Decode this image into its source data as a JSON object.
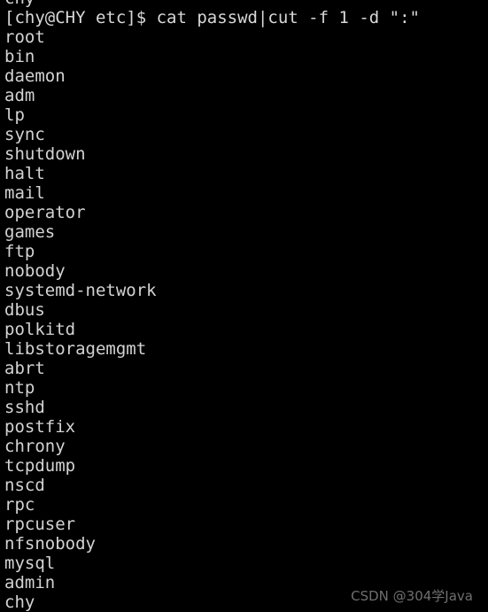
{
  "terminal": {
    "background_color": "#000000",
    "foreground_color": "#d3d3d3",
    "clipped_top_line": "chy",
    "prompt_line": "[chy@CHY etc]$ cat passwd|cut -f 1 -d \":\"",
    "output_lines": [
      "root",
      "bin",
      "daemon",
      "adm",
      "lp",
      "sync",
      "shutdown",
      "halt",
      "mail",
      "operator",
      "games",
      "ftp",
      "nobody",
      "systemd-network",
      "dbus",
      "polkitd",
      "libstoragemgmt",
      "abrt",
      "ntp",
      "sshd",
      "postfix",
      "chrony",
      "tcpdump",
      "nscd",
      "rpc",
      "rpcuser",
      "nfsnobody",
      "mysql",
      "admin",
      "chy"
    ]
  },
  "watermark": {
    "text": "CSDN @304学Java",
    "color": "#6f6f6f"
  }
}
